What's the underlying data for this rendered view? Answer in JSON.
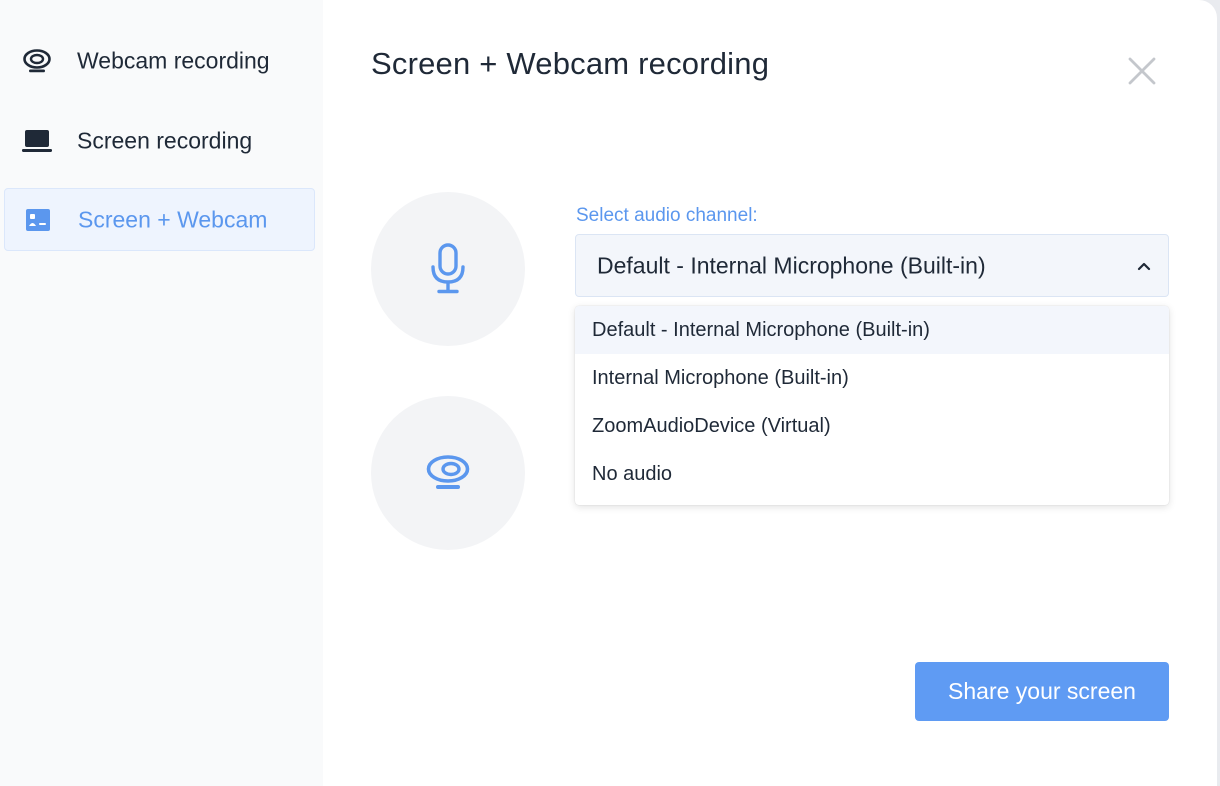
{
  "sidebar": {
    "items": [
      {
        "label": "Webcam recording",
        "icon": "webcam-icon",
        "active": false
      },
      {
        "label": "Screen recording",
        "icon": "laptop-icon",
        "active": false
      },
      {
        "label": "Screen + Webcam",
        "icon": "screen-webcam-icon",
        "active": true
      }
    ]
  },
  "main": {
    "title": "Screen + Webcam recording",
    "close_icon": "close-icon",
    "audio": {
      "label": "Select audio channel:",
      "selected": "Default - Internal Microphone (Built-in)",
      "options": [
        "Default - Internal Microphone (Built-in)",
        "Internal Microphone (Built-in)",
        "ZoomAudioDevice (Virtual)",
        "No audio"
      ]
    },
    "share_button": "Share your screen"
  },
  "colors": {
    "accent": "#5b97ee",
    "button": "#5f9bf3",
    "text": "#1f2937",
    "sidebar_bg": "#f9fafb",
    "circle_bg": "#f3f4f6"
  }
}
